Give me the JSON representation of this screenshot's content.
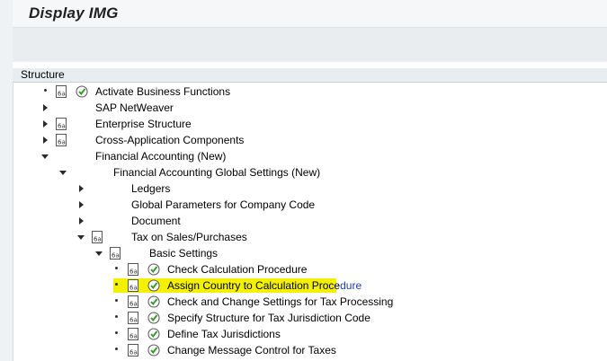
{
  "window": {
    "title": "Display IMG"
  },
  "structure": {
    "header": "Structure"
  },
  "tree": [
    {
      "label": "Activate Business Functions",
      "node": "bullet",
      "doc": true,
      "exec": true
    },
    {
      "label": "SAP NetWeaver",
      "node": "collapsed",
      "doc": false,
      "exec": false
    },
    {
      "label": "Enterprise Structure",
      "node": "collapsed",
      "doc": true,
      "exec": false
    },
    {
      "label": "Cross-Application Components",
      "node": "collapsed",
      "doc": true,
      "exec": false
    },
    {
      "label": "Financial Accounting (New)",
      "node": "expanded",
      "doc": false,
      "exec": false
    },
    {
      "label": "Financial Accounting Global Settings (New)",
      "node": "expanded",
      "doc": false,
      "exec": false
    },
    {
      "label": "Ledgers",
      "node": "collapsed",
      "doc": false,
      "exec": false
    },
    {
      "label": "Global Parameters for Company Code",
      "node": "collapsed",
      "doc": false,
      "exec": false
    },
    {
      "label": "Document",
      "node": "collapsed",
      "doc": false,
      "exec": false
    },
    {
      "label": "Tax on Sales/Purchases",
      "node": "expanded",
      "doc": true,
      "exec": false
    },
    {
      "label": "Basic Settings",
      "node": "expanded",
      "doc": true,
      "exec": false
    },
    {
      "label": "Check Calculation Procedure",
      "node": "bullet",
      "doc": true,
      "exec": true
    },
    {
      "label_highlighted": "Assign Country to Calculation Proce",
      "label_link": "dure",
      "node": "bullet",
      "doc": true,
      "exec": true,
      "highlighted": true
    },
    {
      "label": "Check and Change Settings for Tax Processing",
      "node": "bullet",
      "doc": true,
      "exec": true
    },
    {
      "label": "Specify Structure for Tax Jurisdiction Code",
      "node": "bullet",
      "doc": true,
      "exec": true
    },
    {
      "label": "Define Tax Jurisdictions",
      "node": "bullet",
      "doc": true,
      "exec": true
    },
    {
      "label": "Change Message Control for Taxes",
      "node": "bullet",
      "doc": true,
      "exec": true
    }
  ],
  "colors": {
    "highlight": "#f4f000",
    "exec_green": "#3a9a2e",
    "link_blue": "#1a3fb5"
  },
  "icons": {
    "doc": "documentation-icon",
    "exec": "execute-activity-icon"
  }
}
